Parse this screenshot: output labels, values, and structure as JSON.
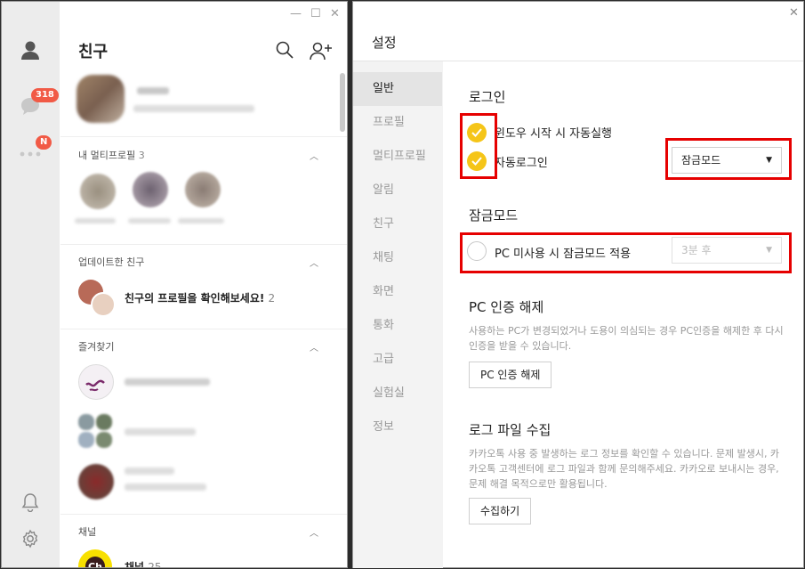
{
  "left": {
    "badges": {
      "chat": "318",
      "more": "N"
    },
    "window_controls": {
      "minimize": "—",
      "maximize": "☐",
      "close": "✕"
    },
    "title": "친구",
    "sections": {
      "multi_profile": {
        "label": "내 멀티프로필",
        "count": "3"
      },
      "updated": {
        "label": "업데이트한 친구",
        "message": "친구의 프로필을 확인해보세요!",
        "count": "2"
      },
      "favorites": {
        "label": "즐겨찾기"
      },
      "channel": {
        "label": "채널",
        "logo": "Ch",
        "name": "채널",
        "count": "25"
      }
    }
  },
  "settings": {
    "title": "설정",
    "close": "✕",
    "menu": [
      "일반",
      "프로필",
      "멀티프로필",
      "알림",
      "친구",
      "채팅",
      "화면",
      "통화",
      "고급",
      "실험실",
      "정보"
    ],
    "login": {
      "heading": "로그인",
      "autostart": "윈도우 시작 시 자동실행",
      "autologin": "자동로그인",
      "mode_select": "잠금모드"
    },
    "lock": {
      "heading": "잠금모드",
      "option": "PC 미사용 시 잠금모드 적용",
      "delay_select": "3분 후"
    },
    "pc_auth": {
      "heading": "PC 인증 해제",
      "desc": "사용하는 PC가 변경되었거나 도용이 의심되는 경우 PC인증을 해제한 후 다시 인증을 받을 수 있습니다.",
      "button": "PC 인증 해제"
    },
    "log": {
      "heading": "로그 파일 수집",
      "desc": "카카오톡 사용 중 발생하는 로그 정보를 확인할 수 있습니다. 문제 발생시, 카카오톡 고객센터에 로그 파일과 함께 문의해주세요. 카카오로 보내시는 경우, 문제 해결 목적으로만 활용됩니다.",
      "button": "수집하기"
    }
  },
  "colors": {
    "accent": "#f5c518",
    "badge": "#f15a46",
    "highlight": "#e60000"
  }
}
